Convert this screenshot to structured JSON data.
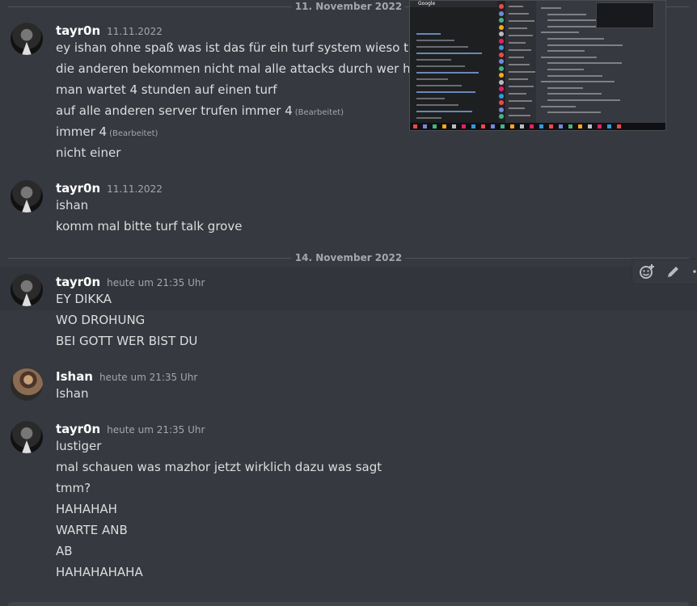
{
  "dividers": {
    "d1": "11. November 2022",
    "d2": "14. November 2022"
  },
  "messages": [
    {
      "author": "tayr0n",
      "timestamp": "11.11.2022",
      "lines": [
        "ey ishan ohne spaß was ist das für ein turf system wieso turfen imr",
        "die anderen bekommen nicht mal alle attacks durch wer hat sich d",
        "man wartet 4 stunden auf einen turf",
        "auf alle anderen server trufen immer 4",
        "immer 4",
        "nicht einer"
      ],
      "edited": "(Bearbeitet)"
    },
    {
      "author": "tayr0n",
      "timestamp": "11.11.2022",
      "lines": [
        "ishan",
        "komm mal bitte turf talk grove"
      ]
    },
    {
      "author": "tayr0n",
      "timestamp": "heute um 21:35 Uhr",
      "lines": [
        "EY DIKKA",
        "WO DROHUNG",
        "BEI GOTT WER BIST DU"
      ]
    },
    {
      "author": "Ishan",
      "timestamp": "heute um 21:35 Uhr",
      "lines": [
        "Ishan"
      ]
    },
    {
      "author": "tayr0n",
      "timestamp": "heute um 21:35 Uhr",
      "lines": [
        "lustiger",
        "mal schauen was mazhor jetzt wirklich dazu was sagt",
        "tmm?",
        "HAHAHAH",
        "WARTE ANB",
        "AB",
        "HAHAHAHAHA"
      ]
    }
  ],
  "embedded_screenshot": {
    "label": "Google"
  },
  "icons": {
    "reaction": "add-reaction-icon",
    "edit": "pencil-icon",
    "more": "more-icon"
  }
}
